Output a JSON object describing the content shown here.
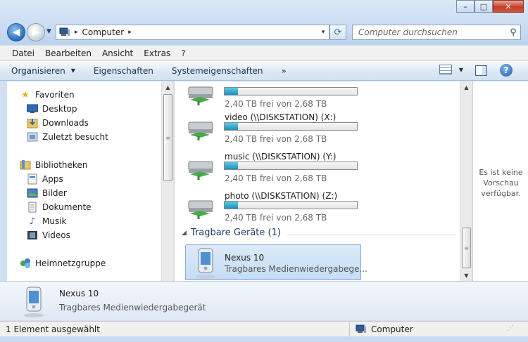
{
  "window": {
    "minimize_label": "–",
    "maximize_label": "□",
    "close_label": "✕"
  },
  "nav": {
    "back": "◀",
    "forward": "▶",
    "history": "▼"
  },
  "address": {
    "separator": "▸",
    "location": "Computer",
    "sub_separator": "▸",
    "dropdown": "▾"
  },
  "search": {
    "placeholder": "Computer durchsuchen"
  },
  "menubar": {
    "items": [
      "Datei",
      "Bearbeiten",
      "Ansicht",
      "Extras",
      "?"
    ]
  },
  "commandbar": {
    "organize": "Organisieren",
    "properties": "Eigenschaften",
    "system_properties": "Systemeigenschaften",
    "more": "»"
  },
  "sidebar": {
    "favorites": {
      "label": "Favoriten",
      "items": [
        "Desktop",
        "Downloads",
        "Zuletzt besucht"
      ]
    },
    "libraries": {
      "label": "Bibliotheken",
      "items": [
        "Apps",
        "Bilder",
        "Dokumente",
        "Musik",
        "Videos"
      ]
    },
    "homegroup": {
      "label": "Heimnetzgruppe"
    }
  },
  "drives": [
    {
      "name": "",
      "free_text": "2,40 TB frei von 2,68 TB",
      "used_fraction": 0.1
    },
    {
      "name": "video (\\\\DISKSTATION) (X:)",
      "free_text": "2,40 TB frei von 2,68 TB",
      "used_fraction": 0.1
    },
    {
      "name": "music (\\\\DISKSTATION) (Y:)",
      "free_text": "2,40 TB frei von 2,68 TB",
      "used_fraction": 0.1
    },
    {
      "name": "photo (\\\\DISKSTATION) (Z:)",
      "free_text": "2,40 TB frei von 2,68 TB",
      "used_fraction": 0.1
    }
  ],
  "portable_group": {
    "header": "Tragbare Geräte (1)"
  },
  "device": {
    "name": "Nexus 10",
    "subtitle": "Tragbares Medienwiedergabege..."
  },
  "preview": {
    "message": "Es ist keine Vorschau verfügbar."
  },
  "details": {
    "name": "Nexus 10",
    "subtitle": "Tragbares Medienwiedergabegerät"
  },
  "status": {
    "selection": "1 Element ausgewählt",
    "location": "Computer"
  },
  "colors": {
    "accent": "#1e8fb8",
    "selection": "#c6ddf5"
  }
}
